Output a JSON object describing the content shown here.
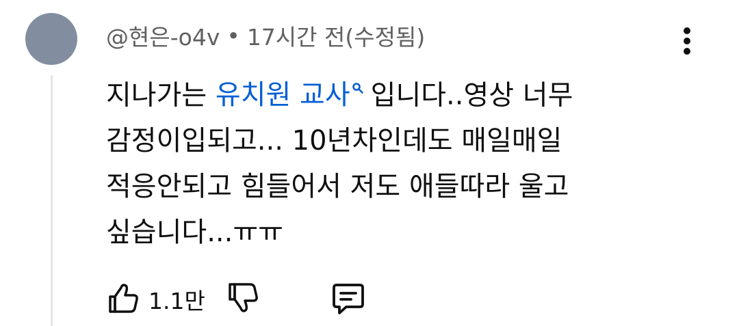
{
  "comment": {
    "author": "@현은-o4v",
    "separator": "•",
    "time": "17시간 전(수정됨)",
    "text": {
      "line1_before_link": "지나가는 ",
      "link_text": "유치원 교사",
      "line1_after_link": "입니다..영상 너무",
      "line2": "감정이입되고... 10년차인데도 매일매일",
      "line3": "적응안되고 힘들어서 저도 애들따라 울고",
      "line4": "싶습니다...ㅠㅠ"
    },
    "like_count": "1.1만"
  },
  "icons": {
    "avatar": "avatar",
    "more": "more-vertical-icon",
    "link_search": "search-icon",
    "like": "thumbs-up-icon",
    "dislike": "thumbs-down-icon",
    "reply": "reply-comment-icon"
  },
  "colors": {
    "avatar": "#828ea0",
    "link": "#065fd4",
    "meta_text": "#606060",
    "body_text": "#0f0f0f",
    "thread_line": "#e5e5e5"
  }
}
